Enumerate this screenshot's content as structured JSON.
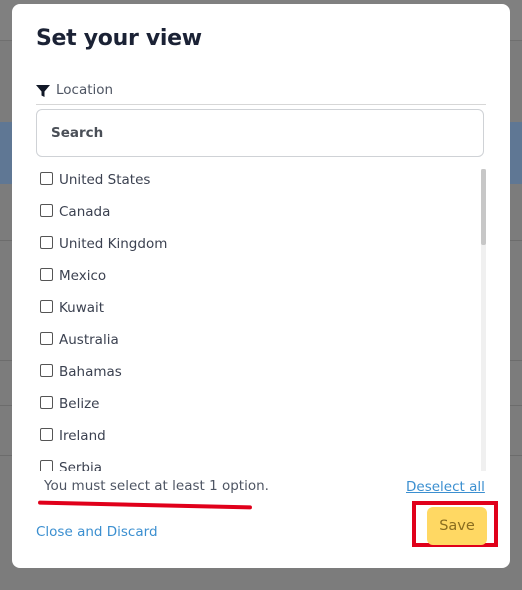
{
  "dialog": {
    "title": "Set your view",
    "filter_label": "Location",
    "search_placeholder": "Search",
    "options": [
      {
        "label": "United States",
        "checked": false
      },
      {
        "label": "Canada",
        "checked": false
      },
      {
        "label": "United Kingdom",
        "checked": false
      },
      {
        "label": "Mexico",
        "checked": false
      },
      {
        "label": "Kuwait",
        "checked": false
      },
      {
        "label": "Australia",
        "checked": false
      },
      {
        "label": "Bahamas",
        "checked": false
      },
      {
        "label": "Belize",
        "checked": false
      },
      {
        "label": "Ireland",
        "checked": false
      },
      {
        "label": "Serbia",
        "checked": false
      }
    ],
    "error_message": "You must select at least 1 option.",
    "deselect_all_label": "Deselect all",
    "close_label": "Close and Discard",
    "save_label": "Save"
  },
  "colors": {
    "link": "#3b8fd0",
    "save_button": "#ffd863",
    "annotation": "#e0001a"
  }
}
